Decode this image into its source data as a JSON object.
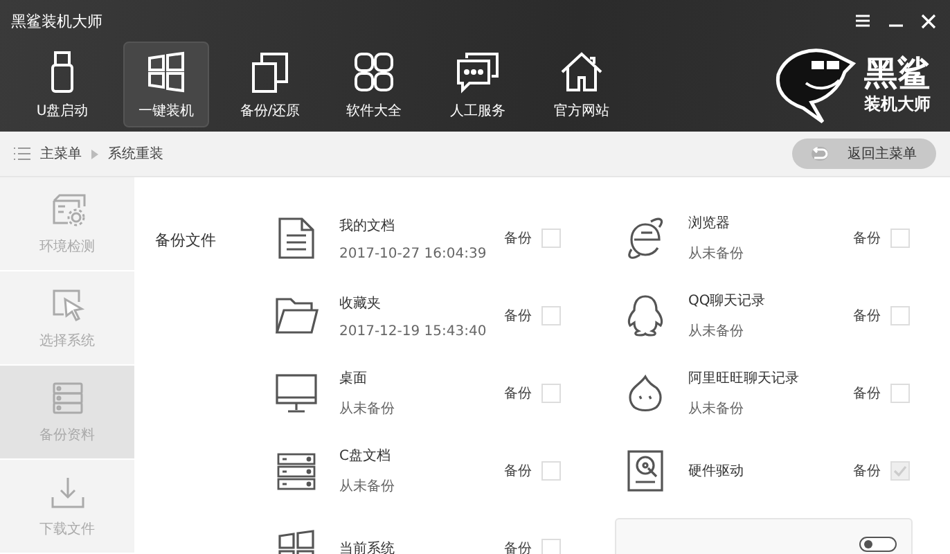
{
  "window": {
    "title": "黑鲨装机大师"
  },
  "toolbar": {
    "items": [
      {
        "label": "U盘启动",
        "selected": false
      },
      {
        "label": "一键装机",
        "selected": true
      },
      {
        "label": "备份/还原",
        "selected": false
      },
      {
        "label": "软件大全",
        "selected": false
      },
      {
        "label": "人工服务",
        "selected": false
      },
      {
        "label": "官方网站",
        "selected": false
      }
    ]
  },
  "logo": {
    "title": "黑鲨",
    "subtitle": "装机大师"
  },
  "breadcrumb": {
    "items": [
      "主菜单",
      "系统重装"
    ],
    "back_button": "返回主菜单"
  },
  "sidebar": {
    "items": [
      {
        "label": "环境检测",
        "selected": false
      },
      {
        "label": "选择系统",
        "selected": false
      },
      {
        "label": "备份资料",
        "selected": true
      },
      {
        "label": "下载文件",
        "selected": false
      }
    ]
  },
  "section_label": "备份文件",
  "left_items": [
    {
      "name": "我的文档",
      "status": "2017-10-27 16:04:39",
      "checkbox_label": "备份",
      "checked": false,
      "disabled": false
    },
    {
      "name": "收藏夹",
      "status": "2017-12-19 15:43:40",
      "checkbox_label": "备份",
      "checked": false,
      "disabled": false
    },
    {
      "name": "桌面",
      "status": "从未备份",
      "checkbox_label": "备份",
      "checked": false,
      "disabled": false
    },
    {
      "name": "C盘文档",
      "status": "从未备份",
      "checkbox_label": "备份",
      "checked": false,
      "disabled": false
    },
    {
      "name": "当前系统",
      "checkbox_label": "备份",
      "checked": false,
      "disabled": false
    }
  ],
  "right_items": [
    {
      "name": "浏览器",
      "status": "从未备份",
      "checkbox_label": "备份",
      "checked": false,
      "disabled": false
    },
    {
      "name": "QQ聊天记录",
      "status": "从未备份",
      "checkbox_label": "备份",
      "checked": false,
      "disabled": false
    },
    {
      "name": "阿里旺旺聊天记录",
      "status": "从未备份",
      "checkbox_label": "备份",
      "checked": false,
      "disabled": false
    },
    {
      "name": "硬件驱动",
      "checkbox_label": "备份",
      "checked": true,
      "disabled": true
    }
  ]
}
